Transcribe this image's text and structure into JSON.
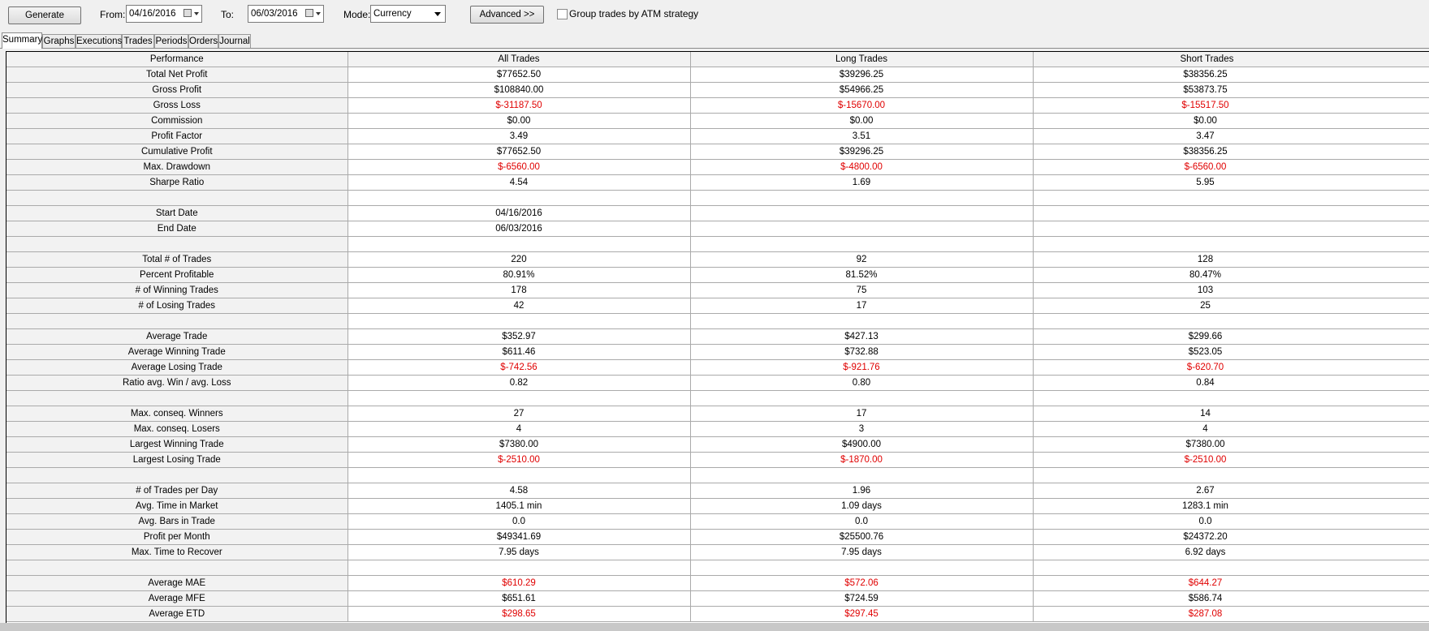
{
  "toolbar": {
    "generate_label": "Generate",
    "from_label": "From:",
    "from_value": "04/16/2016",
    "to_label": "To:",
    "to_value": "06/03/2016",
    "mode_label": "Mode:",
    "mode_value": "Currency",
    "advanced_label": "Advanced >>",
    "group_label": "Group trades by ATM strategy"
  },
  "tabs": [
    "Summary",
    "Graphs",
    "Executions",
    "Trades",
    "Periods",
    "Orders",
    "Journal"
  ],
  "table": {
    "headers": [
      "Performance",
      "All Trades",
      "Long Trades",
      "Short Trades"
    ],
    "rows": [
      {
        "label": "Total Net Profit",
        "values": [
          "$77652.50",
          "$39296.25",
          "$38356.25"
        ],
        "neg": [
          false,
          false,
          false
        ]
      },
      {
        "label": "Gross Profit",
        "values": [
          "$108840.00",
          "$54966.25",
          "$53873.75"
        ],
        "neg": [
          false,
          false,
          false
        ]
      },
      {
        "label": "Gross Loss",
        "values": [
          "$-31187.50",
          "$-15670.00",
          "$-15517.50"
        ],
        "neg": [
          true,
          true,
          true
        ]
      },
      {
        "label": "Commission",
        "values": [
          "$0.00",
          "$0.00",
          "$0.00"
        ],
        "neg": [
          false,
          false,
          false
        ]
      },
      {
        "label": "Profit Factor",
        "values": [
          "3.49",
          "3.51",
          "3.47"
        ],
        "neg": [
          false,
          false,
          false
        ]
      },
      {
        "label": "Cumulative Profit",
        "values": [
          "$77652.50",
          "$39296.25",
          "$38356.25"
        ],
        "neg": [
          false,
          false,
          false
        ]
      },
      {
        "label": "Max. Drawdown",
        "values": [
          "$-6560.00",
          "$-4800.00",
          "$-6560.00"
        ],
        "neg": [
          true,
          true,
          true
        ]
      },
      {
        "label": "Sharpe Ratio",
        "values": [
          "4.54",
          "1.69",
          "5.95"
        ],
        "neg": [
          false,
          false,
          false
        ]
      },
      {
        "label": "",
        "values": [
          "",
          "",
          ""
        ],
        "neg": [
          false,
          false,
          false
        ]
      },
      {
        "label": "Start Date",
        "values": [
          "04/16/2016",
          "",
          ""
        ],
        "neg": [
          false,
          false,
          false
        ]
      },
      {
        "label": "End Date",
        "values": [
          "06/03/2016",
          "",
          ""
        ],
        "neg": [
          false,
          false,
          false
        ]
      },
      {
        "label": "",
        "values": [
          "",
          "",
          ""
        ],
        "neg": [
          false,
          false,
          false
        ]
      },
      {
        "label": "Total # of Trades",
        "values": [
          "220",
          "92",
          "128"
        ],
        "neg": [
          false,
          false,
          false
        ]
      },
      {
        "label": "Percent Profitable",
        "values": [
          "80.91%",
          "81.52%",
          "80.47%"
        ],
        "neg": [
          false,
          false,
          false
        ]
      },
      {
        "label": "# of Winning Trades",
        "values": [
          "178",
          "75",
          "103"
        ],
        "neg": [
          false,
          false,
          false
        ]
      },
      {
        "label": "# of Losing Trades",
        "values": [
          "42",
          "17",
          "25"
        ],
        "neg": [
          false,
          false,
          false
        ]
      },
      {
        "label": "",
        "values": [
          "",
          "",
          ""
        ],
        "neg": [
          false,
          false,
          false
        ]
      },
      {
        "label": "Average Trade",
        "values": [
          "$352.97",
          "$427.13",
          "$299.66"
        ],
        "neg": [
          false,
          false,
          false
        ]
      },
      {
        "label": "Average Winning Trade",
        "values": [
          "$611.46",
          "$732.88",
          "$523.05"
        ],
        "neg": [
          false,
          false,
          false
        ]
      },
      {
        "label": "Average Losing Trade",
        "values": [
          "$-742.56",
          "$-921.76",
          "$-620.70"
        ],
        "neg": [
          true,
          true,
          true
        ]
      },
      {
        "label": "Ratio avg. Win / avg. Loss",
        "values": [
          "0.82",
          "0.80",
          "0.84"
        ],
        "neg": [
          false,
          false,
          false
        ]
      },
      {
        "label": "",
        "values": [
          "",
          "",
          ""
        ],
        "neg": [
          false,
          false,
          false
        ]
      },
      {
        "label": "Max. conseq. Winners",
        "values": [
          "27",
          "17",
          "14"
        ],
        "neg": [
          false,
          false,
          false
        ]
      },
      {
        "label": "Max. conseq. Losers",
        "values": [
          "4",
          "3",
          "4"
        ],
        "neg": [
          false,
          false,
          false
        ]
      },
      {
        "label": "Largest Winning Trade",
        "values": [
          "$7380.00",
          "$4900.00",
          "$7380.00"
        ],
        "neg": [
          false,
          false,
          false
        ]
      },
      {
        "label": "Largest Losing Trade",
        "values": [
          "$-2510.00",
          "$-1870.00",
          "$-2510.00"
        ],
        "neg": [
          true,
          true,
          true
        ]
      },
      {
        "label": "",
        "values": [
          "",
          "",
          ""
        ],
        "neg": [
          false,
          false,
          false
        ]
      },
      {
        "label": "# of Trades per Day",
        "values": [
          "4.58",
          "1.96",
          "2.67"
        ],
        "neg": [
          false,
          false,
          false
        ]
      },
      {
        "label": "Avg. Time in Market",
        "values": [
          "1405.1 min",
          "1.09 days",
          "1283.1 min"
        ],
        "neg": [
          false,
          false,
          false
        ]
      },
      {
        "label": "Avg. Bars in Trade",
        "values": [
          "0.0",
          "0.0",
          "0.0"
        ],
        "neg": [
          false,
          false,
          false
        ]
      },
      {
        "label": "Profit per Month",
        "values": [
          "$49341.69",
          "$25500.76",
          "$24372.20"
        ],
        "neg": [
          false,
          false,
          false
        ]
      },
      {
        "label": "Max. Time to Recover",
        "values": [
          "7.95 days",
          "7.95 days",
          "6.92 days"
        ],
        "neg": [
          false,
          false,
          false
        ]
      },
      {
        "label": "",
        "values": [
          "",
          "",
          ""
        ],
        "neg": [
          false,
          false,
          false
        ]
      },
      {
        "label": "Average MAE",
        "values": [
          "$610.29",
          "$572.06",
          "$644.27"
        ],
        "neg": [
          true,
          true,
          true
        ]
      },
      {
        "label": "Average MFE",
        "values": [
          "$651.61",
          "$724.59",
          "$586.74"
        ],
        "neg": [
          false,
          false,
          false
        ]
      },
      {
        "label": "Average ETD",
        "values": [
          "$298.65",
          "$297.45",
          "$287.08"
        ],
        "neg": [
          true,
          true,
          true
        ]
      }
    ]
  },
  "colors": {
    "negative": "#e00000",
    "label_bg": "#f2f2f2"
  }
}
